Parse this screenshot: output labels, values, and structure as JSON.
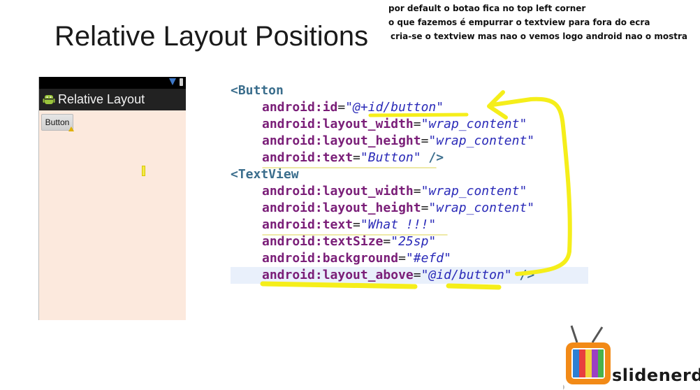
{
  "slide": {
    "title": "Relative Layout Positions"
  },
  "notes": [
    "por default o botao fica no top left corner",
    "o que fazemos é empurrar o textview para fora do ecra",
    "cria-se o textview mas nao o vemos logo android nao o mostra"
  ],
  "phone": {
    "app_title": "Relative Layout",
    "button_label": "Button",
    "icons": [
      "signal-icon",
      "battery-icon",
      "android-app-icon",
      "warning-icon"
    ]
  },
  "code": {
    "button_tag": "<Button",
    "button_id_attr": "android:id",
    "button_id_val": "\"@+id/button\"",
    "button_width_attr": "android:layout_width",
    "button_width_val": "\"wrap_content\"",
    "button_height_attr": "android:layout_height",
    "button_height_val": "\"wrap_content\"",
    "button_text_attr": "android:text",
    "button_text_val": "\"Button\"",
    "button_close": " />",
    "textview_tag": "<TextView",
    "tv_width_attr": "android:layout_width",
    "tv_width_val": "\"wrap_content\"",
    "tv_height_attr": "android:layout_height",
    "tv_height_val": "\"wrap_content\"",
    "tv_text_attr": "android:text",
    "tv_text_val": "\"What !!!\"",
    "tv_size_attr": "android:textSize",
    "tv_size_val": "\"25sp\"",
    "tv_bg_attr": "android:background",
    "tv_bg_val": "\"#efd\"",
    "tv_above_attr": "android:layout_above",
    "tv_above_val": "\"@id/button\"",
    "tv_close": " />",
    "equals": "="
  },
  "logo": {
    "brand": "slidenerd"
  },
  "colors": {
    "highlighter": "#f5ee1a",
    "phone_background": "#fce9dd",
    "xml_tag": "#3a6d8c",
    "xml_attribute": "#7a1e78",
    "xml_value": "#2a2ab8",
    "line_highlight": "#e9f0fb"
  }
}
